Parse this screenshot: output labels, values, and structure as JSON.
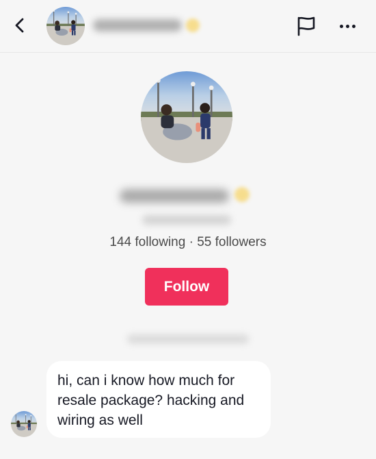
{
  "header": {
    "back_icon": "chevron-left-icon",
    "report_icon": "flag-icon",
    "more_icon": "more-dots-icon"
  },
  "profile": {
    "stats": "144 following · 55 followers",
    "follow_label": "Follow"
  },
  "message": {
    "lines": [
      "hi, can i know how much for",
      "resale package? hacking and",
      "wiring as well"
    ]
  },
  "colors": {
    "background": "#f6f6f6",
    "follow_button": "#f0305b",
    "bubble": "#ffffff",
    "text": "#161823"
  }
}
